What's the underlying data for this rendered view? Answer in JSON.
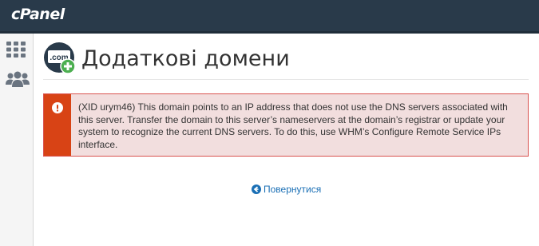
{
  "header": {
    "brand": "cPanel"
  },
  "sidebar": {
    "items": [
      {
        "icon": "grid-icon"
      },
      {
        "icon": "users-icon"
      }
    ]
  },
  "page": {
    "icon_label": ".com",
    "title": "Додаткові домени"
  },
  "alert": {
    "message": "(XID urym46) This domain points to an IP address that does not use the DNS servers associated with this server. Transfer the domain to this server’s nameservers at the domain’s registrar or update your system to recognize the current DNS servers. To do this, use WHM’s Configure Remote Service IPs interface.",
    "color": "#d84315",
    "background": "#f2dede"
  },
  "return_link": {
    "label": "Повернутися",
    "color": "#1a6fb5"
  }
}
